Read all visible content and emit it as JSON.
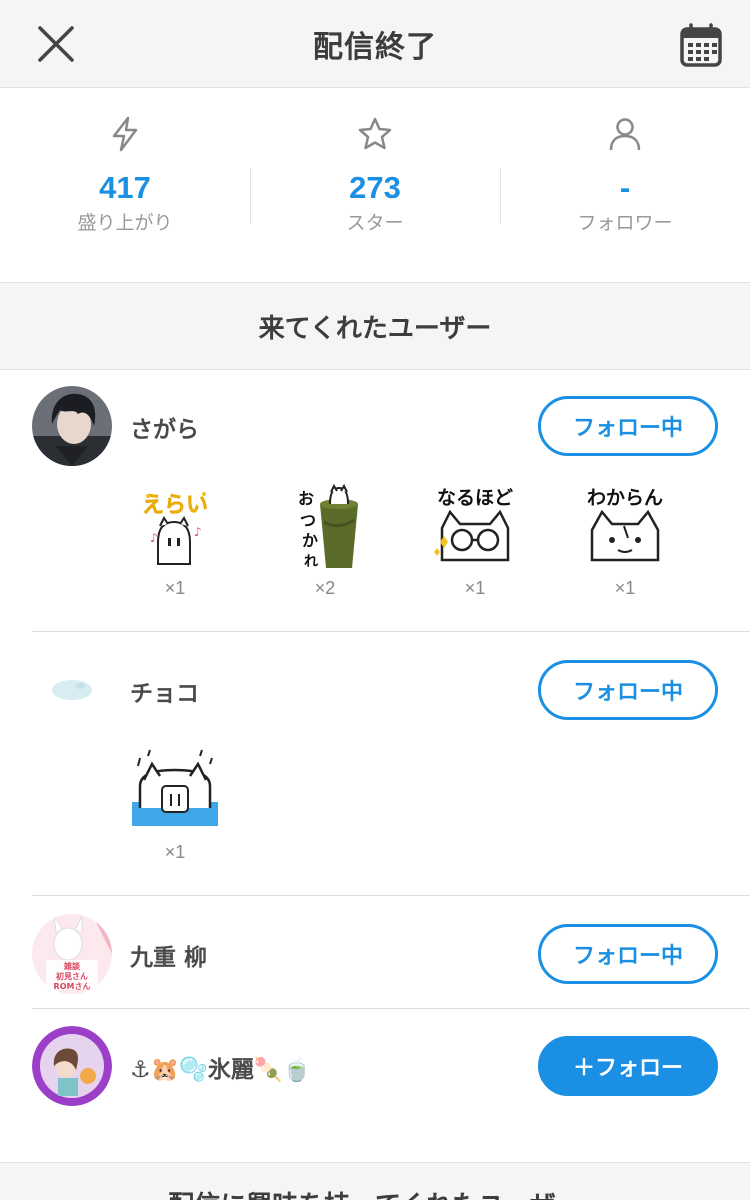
{
  "header": {
    "title": "配信終了"
  },
  "stats": [
    {
      "icon": "lightning-icon",
      "value": "417",
      "label": "盛り上がり"
    },
    {
      "icon": "star-icon",
      "value": "273",
      "label": "スター"
    },
    {
      "icon": "person-icon",
      "value": "-",
      "label": "フォロワー"
    }
  ],
  "visitors": {
    "title": "来てくれたユーザー"
  },
  "users": [
    {
      "name": "さがら",
      "follow_label": "フォロー中",
      "stamps": [
        {
          "text": "えらい",
          "count": "×1"
        },
        {
          "text": "おつかれさま",
          "count": "×2"
        },
        {
          "text": "なるほど",
          "count": "×1"
        },
        {
          "text": "わからん",
          "count": "×1"
        }
      ]
    },
    {
      "name": "チョコ",
      "follow_label": "フォロー中",
      "stamps": [
        {
          "text": "",
          "count": "×1"
        }
      ]
    },
    {
      "name": "九重 柳",
      "follow_label": "フォロー中",
      "avatar_text": [
        "雑談",
        "初見さん",
        "ROMさん"
      ]
    },
    {
      "name": "⚓🐹🫧氷麗🍡🍵",
      "follow_label": "＋フォロー"
    }
  ],
  "next_section": {
    "title": "配信に興味を持ってくれたユーザー"
  },
  "colors": {
    "accent": "#1a8fe3",
    "header_bg": "#f5f5f7"
  }
}
